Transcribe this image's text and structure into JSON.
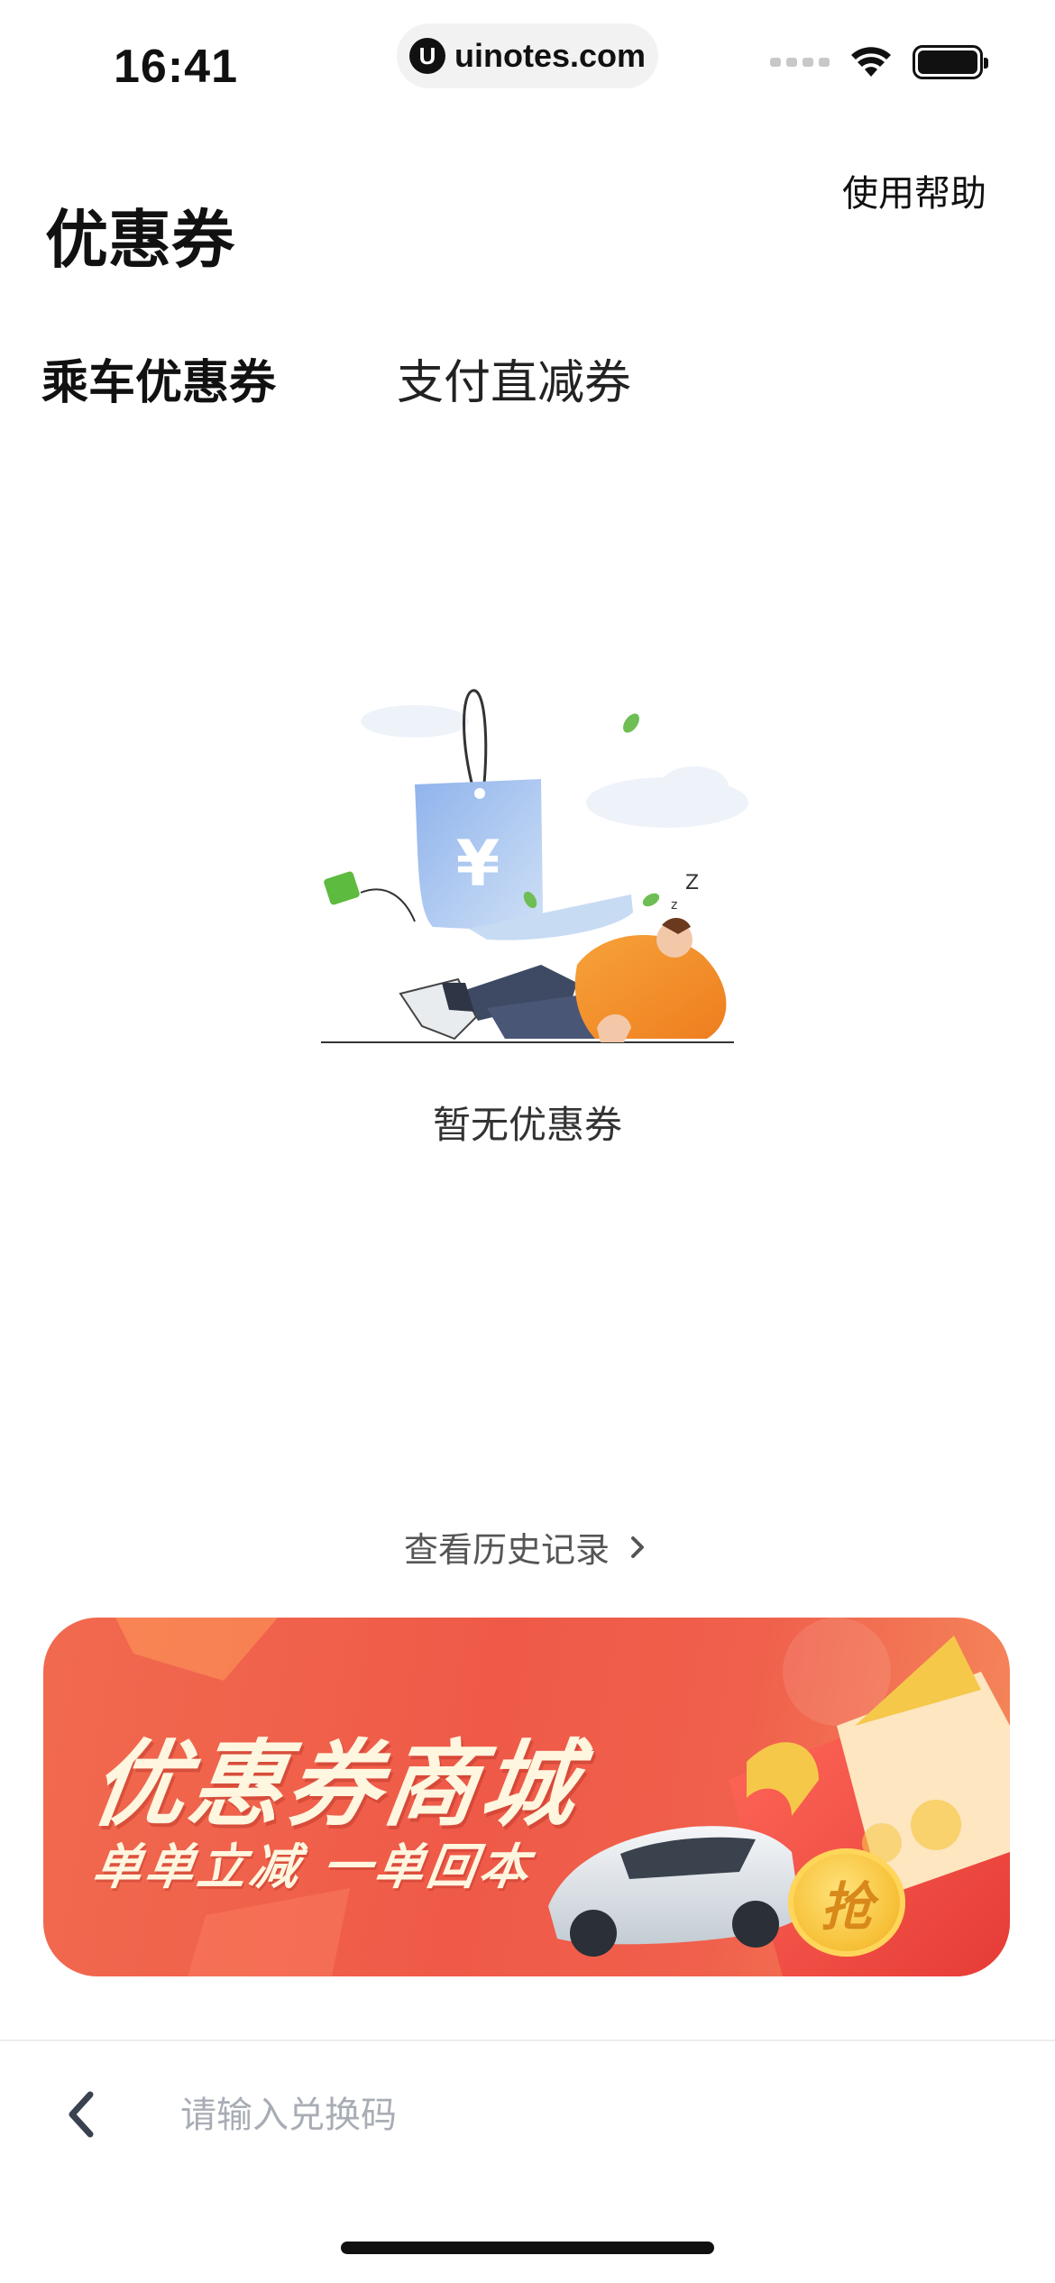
{
  "status_bar": {
    "time": "16:41",
    "url": "uinotes.com",
    "url_logo": "U"
  },
  "header": {
    "title": "优惠券",
    "help_label": "使用帮助"
  },
  "tabs": [
    {
      "label": "乘车优惠券",
      "active": true
    },
    {
      "label": "支付直减券",
      "active": false
    }
  ],
  "empty_state": {
    "message": "暂无优惠券",
    "illustration_icon": "sleeping-person-coupon-illustration"
  },
  "history": {
    "label": "查看历史记录"
  },
  "banner": {
    "title": "优惠券商城",
    "subtitle": "单单立减 一单回本",
    "coin_label": "抢"
  },
  "bottom_bar": {
    "input_placeholder": "请输入兑换码",
    "back_icon": "chevron-left-icon"
  },
  "colors": {
    "tab_highlight": "#d8f24a",
    "banner_red": "#ef5a48",
    "coin_gold": "#f7c23a",
    "placeholder_gray": "#a8adb5"
  }
}
